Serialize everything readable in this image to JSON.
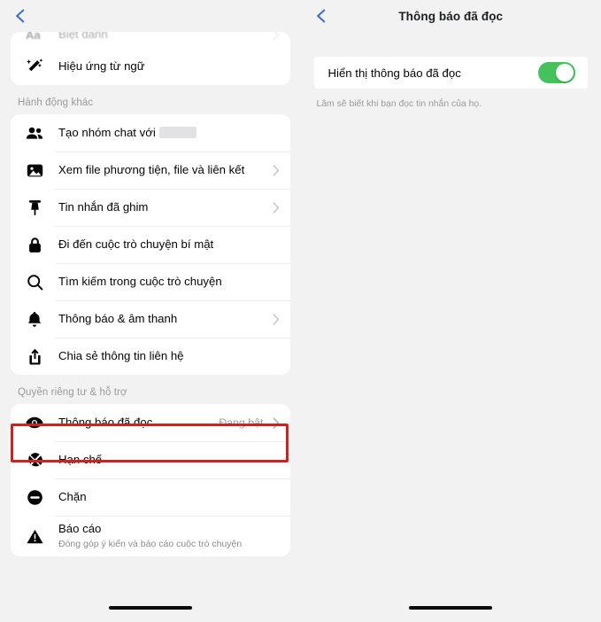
{
  "left_panel": {
    "back_label": "Back",
    "clipped_row": {
      "label": "Biệt danh",
      "icon": "aa-text-icon"
    },
    "top_card": {
      "rows": [
        {
          "label": "Hiệu ứng từ ngữ",
          "icon": "magic-wand-icon",
          "chevron": false,
          "value": ""
        }
      ]
    },
    "sections": [
      {
        "header": "Hành động khác",
        "rows": [
          {
            "label": "Tạo nhóm chat với",
            "icon": "people-group-icon",
            "chevron": false,
            "value": "",
            "redacted": true
          },
          {
            "label": "Xem file phương tiện, file và liên kết",
            "icon": "photo-icon",
            "chevron": true,
            "value": ""
          },
          {
            "label": "Tin nhắn đã ghim",
            "icon": "pin-icon",
            "chevron": true,
            "value": ""
          },
          {
            "label": "Đi đến cuộc trò chuyện bí mật",
            "icon": "lock-icon",
            "chevron": false,
            "value": ""
          },
          {
            "label": "Tìm kiếm trong cuộc trò chuyện",
            "icon": "search-icon",
            "chevron": false,
            "value": ""
          },
          {
            "label": "Thông báo & âm thanh",
            "icon": "bell-icon",
            "chevron": true,
            "value": ""
          },
          {
            "label": "Chia sẻ thông tin liên hệ",
            "icon": "share-icon",
            "chevron": false,
            "value": ""
          }
        ]
      },
      {
        "header": "Quyền riêng tư & hỗ trợ",
        "rows": [
          {
            "label": "Thông báo đã đọc",
            "icon": "eye-icon",
            "chevron": true,
            "value": "Đang bật",
            "highlighted": true
          },
          {
            "label": "Hạn chế",
            "icon": "restrict-icon",
            "chevron": false,
            "value": ""
          },
          {
            "label": "Chặn",
            "icon": "block-icon",
            "chevron": false,
            "value": ""
          },
          {
            "label": "Báo cáo",
            "sub": "Đóng góp ý kiến và báo cáo cuộc trò chuyện",
            "icon": "warning-icon",
            "chevron": false,
            "value": ""
          }
        ]
      }
    ]
  },
  "right_panel": {
    "back_label": "Back",
    "title": "Thông báo đã đọc",
    "toggle": {
      "label": "Hiển thị thông báo đã đọc",
      "state": "on"
    },
    "caption": "Lâm sẽ biết khi bạn đọc tin nhắn của họ."
  },
  "colors": {
    "background": "#f2f2f2",
    "card": "#ffffff",
    "accent_blue": "#3b6ec8",
    "toggle_green": "#45c25c",
    "highlight_red": "#cc2222",
    "text_primary": "#050505",
    "text_secondary": "#9a9a9d"
  }
}
